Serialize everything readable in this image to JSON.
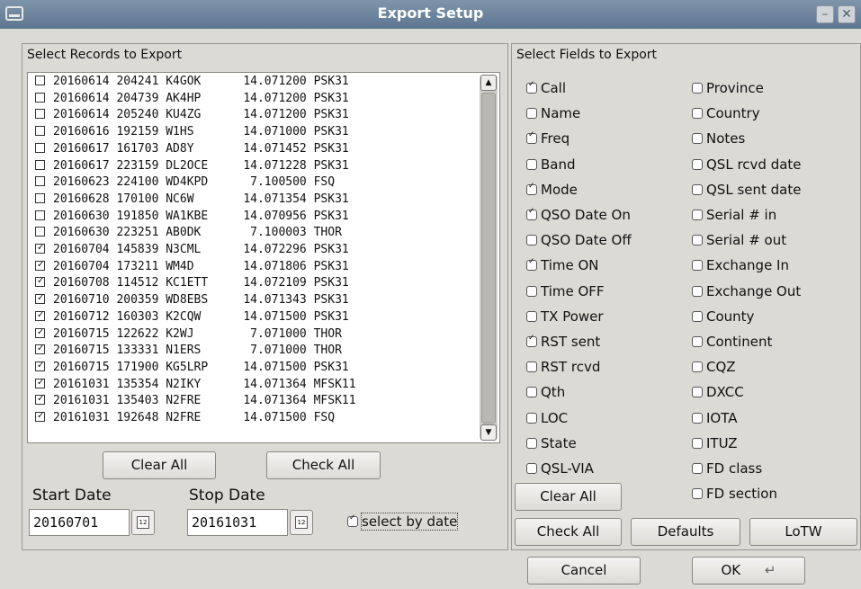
{
  "window": {
    "title": "Export Setup",
    "minimize_glyph": "–",
    "close_glyph": "✕"
  },
  "records": {
    "label": "Select Records to Export",
    "rows": [
      {
        "checked": false,
        "text": "20160614 204241 K4GOK      14.071200 PSK31"
      },
      {
        "checked": false,
        "text": "20160614 204739 AK4HP      14.071200 PSK31"
      },
      {
        "checked": false,
        "text": "20160614 205240 KU4ZG      14.071200 PSK31"
      },
      {
        "checked": false,
        "text": "20160616 192159 W1HS       14.071000 PSK31"
      },
      {
        "checked": false,
        "text": "20160617 161703 AD8Y       14.071452 PSK31"
      },
      {
        "checked": false,
        "text": "20160617 223159 DL2OCE     14.071228 PSK31"
      },
      {
        "checked": false,
        "text": "20160623 224100 WD4KPD      7.100500 FSQ"
      },
      {
        "checked": false,
        "text": "20160628 170100 NC6W       14.071354 PSK31"
      },
      {
        "checked": false,
        "text": "20160630 191850 WA1KBE     14.070956 PSK31"
      },
      {
        "checked": false,
        "text": "20160630 223251 AB0DK       7.100003 THOR"
      },
      {
        "checked": true,
        "text": "20160704 145839 N3CML      14.072296 PSK31"
      },
      {
        "checked": true,
        "text": "20160704 173211 WM4D       14.071806 PSK31"
      },
      {
        "checked": true,
        "text": "20160708 114512 KC1ETT     14.072109 PSK31"
      },
      {
        "checked": true,
        "text": "20160710 200359 WD8EBS     14.071343 PSK31"
      },
      {
        "checked": true,
        "text": "20160712 160303 K2CQW      14.071500 PSK31"
      },
      {
        "checked": true,
        "text": "20160715 122622 K2WJ        7.071000 THOR"
      },
      {
        "checked": true,
        "text": "20160715 133331 N1ERS       7.071000 THOR"
      },
      {
        "checked": true,
        "text": "20160715 171900 KG5LRP     14.071500 PSK31"
      },
      {
        "checked": true,
        "text": "20161031 135354 N2IKY      14.071364 MFSK11"
      },
      {
        "checked": true,
        "text": "20161031 135403 N2FRE      14.071364 MFSK11"
      },
      {
        "checked": true,
        "text": "20161031 192648 N2FRE      14.071500 FSQ"
      }
    ],
    "clear_all": "Clear All",
    "check_all": "Check All",
    "start_date_label": "Start Date",
    "start_date": "20160701",
    "stop_date_label": "Stop Date",
    "stop_date": "20161031",
    "calendar_glyph": "12",
    "select_by_date": "select by date",
    "select_by_date_checked": true
  },
  "fields": {
    "label": "Select Fields to Export",
    "left": [
      {
        "name": "Call",
        "checked": true
      },
      {
        "name": "Name",
        "checked": false
      },
      {
        "name": "Freq",
        "checked": true
      },
      {
        "name": "Band",
        "checked": false
      },
      {
        "name": "Mode",
        "checked": true
      },
      {
        "name": "QSO Date On",
        "checked": true
      },
      {
        "name": "QSO Date Off",
        "checked": false
      },
      {
        "name": "Time ON",
        "checked": true
      },
      {
        "name": "Time OFF",
        "checked": false
      },
      {
        "name": "TX Power",
        "checked": false
      },
      {
        "name": "RST sent",
        "checked": true
      },
      {
        "name": "RST rcvd",
        "checked": false
      },
      {
        "name": "Qth",
        "checked": false
      },
      {
        "name": "LOC",
        "checked": false
      },
      {
        "name": "State",
        "checked": false
      },
      {
        "name": "QSL-VIA",
        "checked": false
      }
    ],
    "right": [
      {
        "name": "Province",
        "checked": false
      },
      {
        "name": "Country",
        "checked": false
      },
      {
        "name": "Notes",
        "checked": false
      },
      {
        "name": "QSL rcvd date",
        "checked": false
      },
      {
        "name": "QSL sent date",
        "checked": false
      },
      {
        "name": "Serial # in",
        "checked": false
      },
      {
        "name": "Serial # out",
        "checked": false
      },
      {
        "name": "Exchange In",
        "checked": false
      },
      {
        "name": "Exchange Out",
        "checked": false
      },
      {
        "name": "County",
        "checked": false
      },
      {
        "name": "Continent",
        "checked": false
      },
      {
        "name": "CQZ",
        "checked": false
      },
      {
        "name": "DXCC",
        "checked": false
      },
      {
        "name": "IOTA",
        "checked": false
      },
      {
        "name": "ITUZ",
        "checked": false
      },
      {
        "name": "FD class",
        "checked": false
      },
      {
        "name": "FD section",
        "checked": false
      }
    ],
    "clear_all": "Clear All",
    "check_all": "Check All",
    "defaults": "Defaults",
    "lotw": "LoTW"
  },
  "footer": {
    "cancel": "Cancel",
    "ok": "OK",
    "ok_glyph": "↵"
  }
}
